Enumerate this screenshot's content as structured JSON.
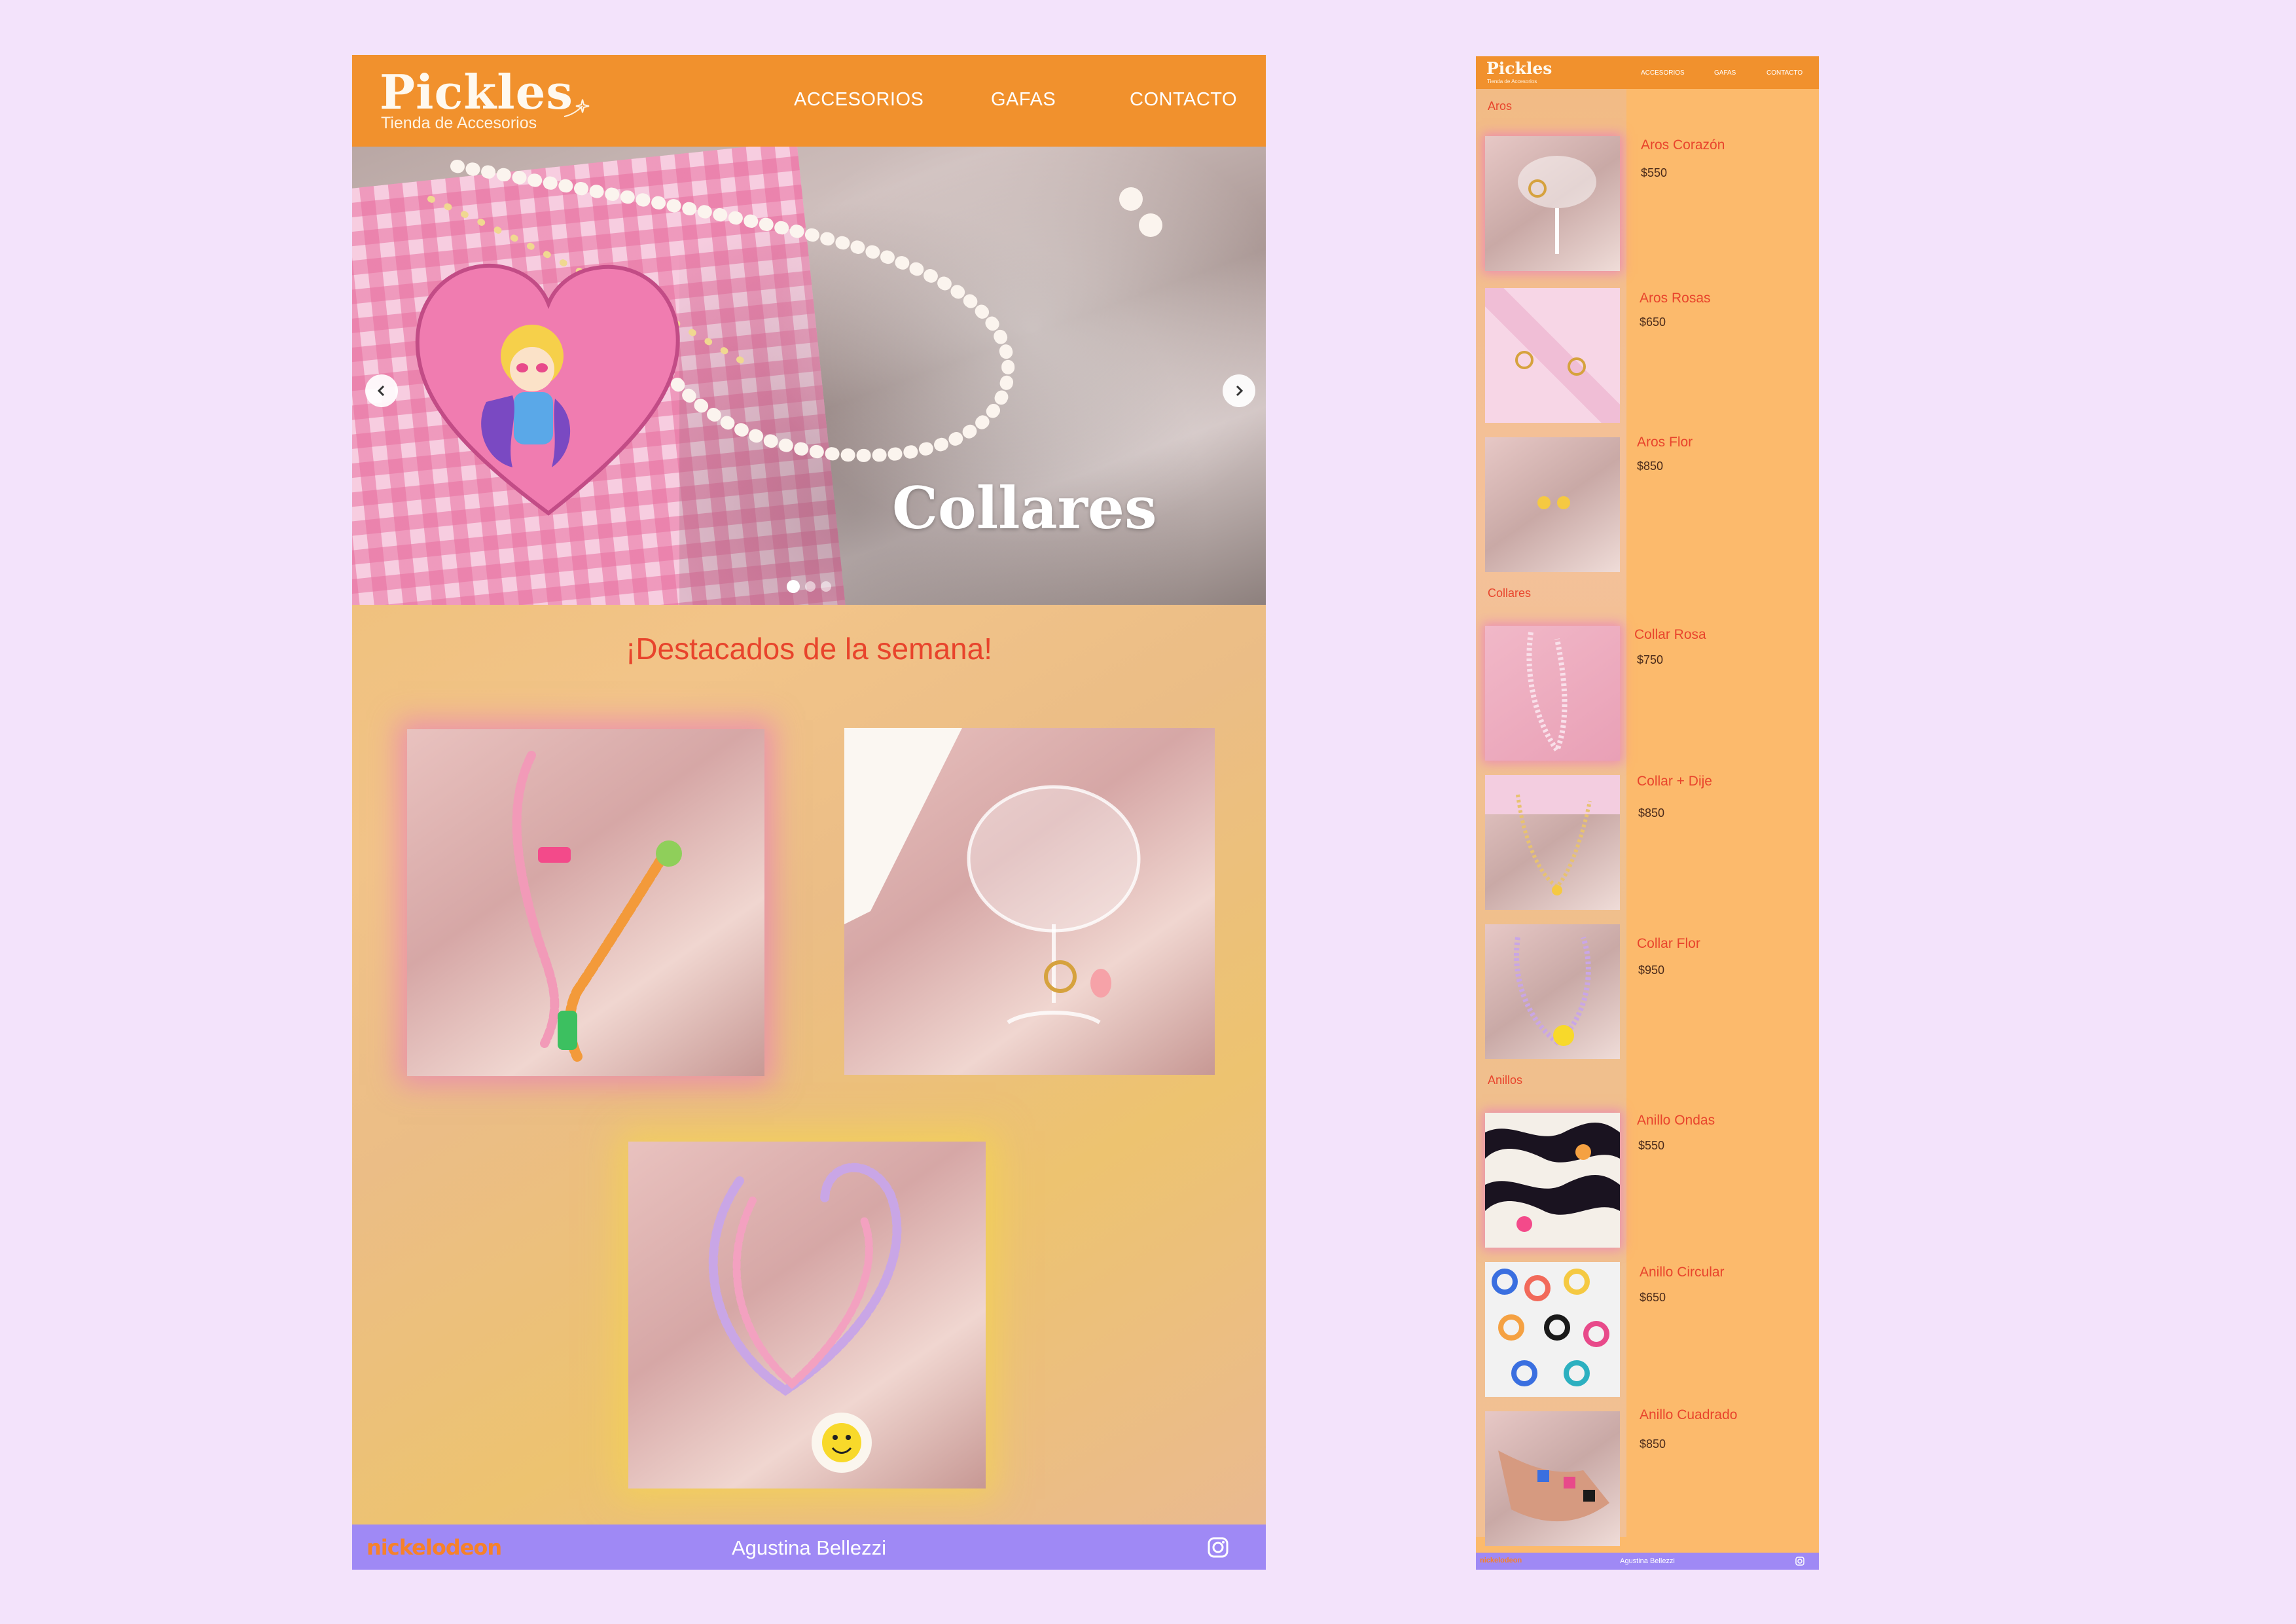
{
  "desktop": {
    "logo": "Pickles",
    "logo_subtitle": "Tienda de Accesorios",
    "nav": [
      "ACCESORIOS",
      "GAFAS",
      "CONTACTO"
    ],
    "hero": {
      "caption": "Collares",
      "slide_count": 3,
      "active_slide": 1
    },
    "featured_title": "¡Destacados de la semana!",
    "footer": {
      "brand": "nickelodeon",
      "author": "Agustina Bellezzi",
      "social_icon": "instagram-icon"
    }
  },
  "mobile": {
    "logo": "Pickles",
    "logo_subtitle": "Tienda de Accesorios",
    "nav": [
      "ACCESORIOS",
      "GAFAS",
      "CONTACTO"
    ],
    "categories": [
      {
        "name": "Aros",
        "products": [
          {
            "name": "Aros Corazón",
            "price": "$550"
          },
          {
            "name": "Aros Rosas",
            "price": "$650"
          },
          {
            "name": "Aros Flor",
            "price": "$850"
          }
        ]
      },
      {
        "name": "Collares",
        "products": [
          {
            "name": "Collar Rosa",
            "price": "$750"
          },
          {
            "name": "Collar + Dije",
            "price": "$850"
          },
          {
            "name": "Collar Flor",
            "price": "$950"
          }
        ]
      },
      {
        "name": "Anillos",
        "products": [
          {
            "name": "Anillo Ondas",
            "price": "$550"
          },
          {
            "name": "Anillo Circular",
            "price": "$650"
          },
          {
            "name": "Anillo Cuadrado",
            "price": "$850"
          }
        ]
      }
    ],
    "footer": {
      "brand": "nickelodeon",
      "author": "Agustina Bellezzi"
    }
  },
  "colors": {
    "page_bg": "#f3e3fb",
    "header": "#f1912d",
    "footer": "#9f89f5",
    "accent_red": "#e8442c",
    "catalog_bg": "#fcba6c"
  }
}
